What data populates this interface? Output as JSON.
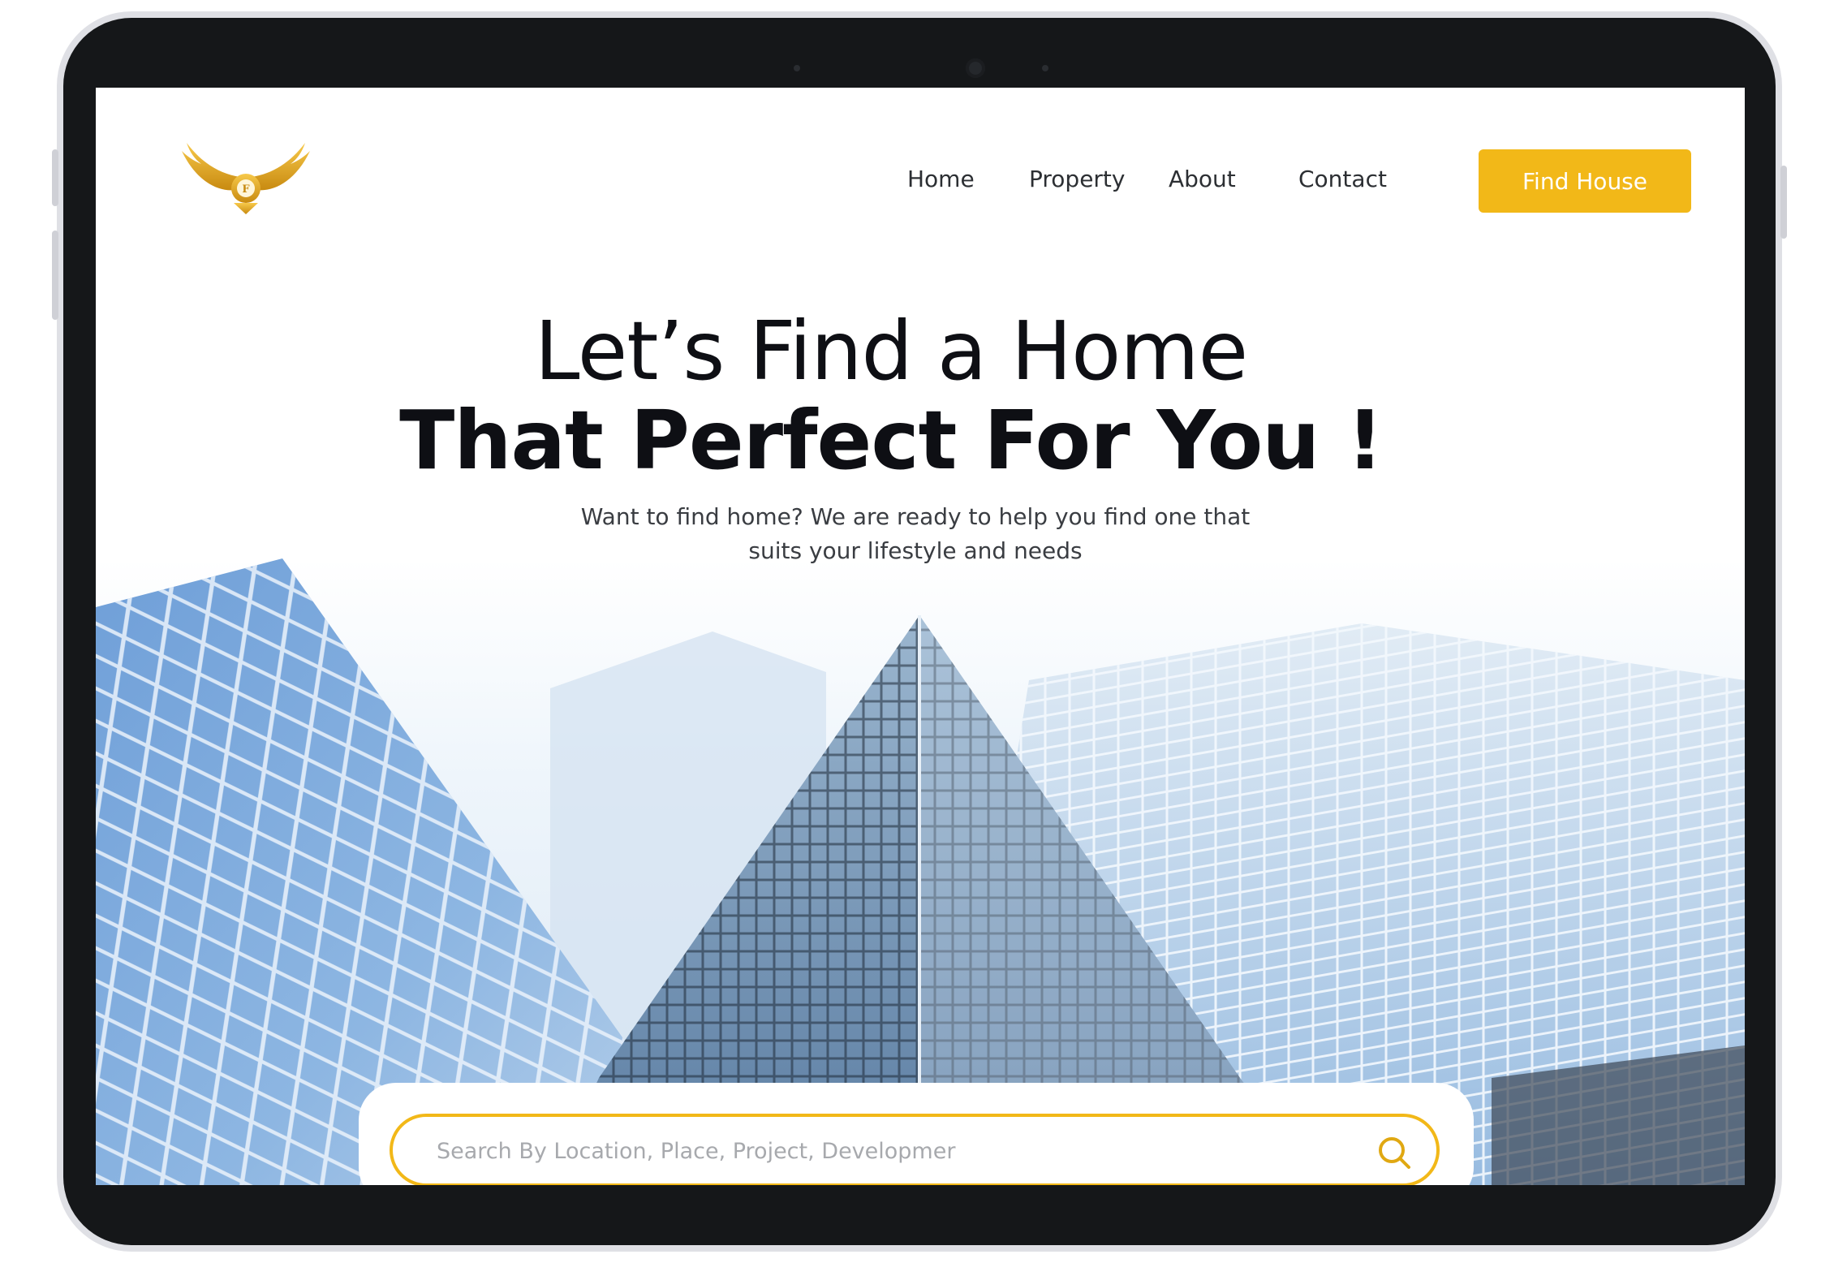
{
  "header": {
    "logo_icon": "golden-winged-emblem",
    "nav": [
      "Home",
      "Property",
      "About",
      "Contact"
    ],
    "cta_label": "Find House"
  },
  "hero": {
    "title_line1": "Let’s Find a Home",
    "title_line2": "That Perfect For You !",
    "subtitle_line1": "Want to find home? We are ready to help you find one that",
    "subtitle_line2": "suits your lifestyle and needs"
  },
  "search": {
    "placeholder": "Search By Location, Place, Project, Developmer",
    "icon": "search-icon"
  },
  "colors": {
    "accent": "#f2b818",
    "text_dark": "#0e0f14",
    "sky": "#eef5fb",
    "glass_blue": "#7fa8d6"
  }
}
